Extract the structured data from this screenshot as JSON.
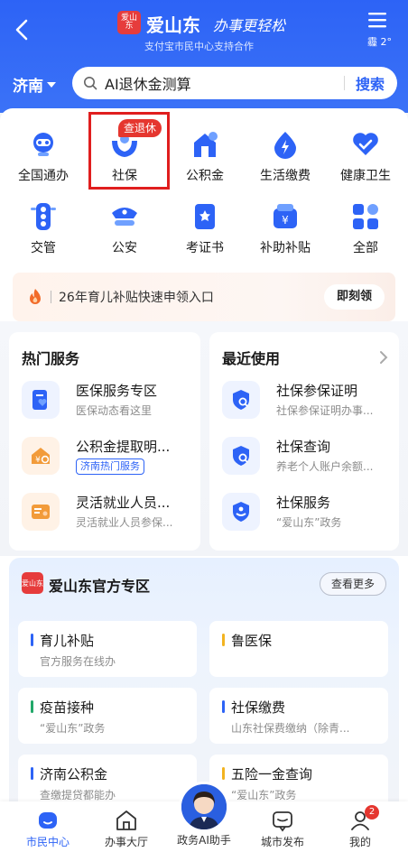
{
  "header": {
    "app_name": "爱山东",
    "badge_text": "爱山东",
    "slogan": "办事更轻松",
    "subtitle": "支付宝市民中心支持合作",
    "weather": "霾 2°",
    "city": "济南",
    "search_placeholder": "AI退休金测算",
    "search_button": "搜索"
  },
  "grid": {
    "items": [
      {
        "label": "全国通办",
        "icon": "nationwide-icon"
      },
      {
        "label": "社保",
        "icon": "social-security-icon",
        "badge": "查退休"
      },
      {
        "label": "公积金",
        "icon": "housing-fund-icon"
      },
      {
        "label": "生活缴费",
        "icon": "bill-payment-icon"
      },
      {
        "label": "健康卫生",
        "icon": "health-icon"
      },
      {
        "label": "交管",
        "icon": "traffic-light-icon"
      },
      {
        "label": "公安",
        "icon": "police-icon"
      },
      {
        "label": "考证书",
        "icon": "certificate-icon"
      },
      {
        "label": "补助补贴",
        "icon": "subsidy-icon"
      },
      {
        "label": "全部",
        "icon": "all-apps-icon"
      }
    ]
  },
  "promo": {
    "text": "26年育儿补贴快速申领入口",
    "button": "即刻领"
  },
  "hot_services": {
    "title": "热门服务",
    "items": [
      {
        "title": "医保服务专区",
        "sub": "医保动态看这里"
      },
      {
        "title": "公积金提取明...",
        "tag": "济南热门服务"
      },
      {
        "title": "灵活就业人员...",
        "sub": "灵活就业人员参保..."
      }
    ]
  },
  "recent": {
    "title": "最近使用",
    "items": [
      {
        "title": "社保参保证明",
        "sub": "社保参保证明办事..."
      },
      {
        "title": "社保查询",
        "sub": "养老个人账户余额..."
      },
      {
        "title": "社保服务",
        "sub": "“爱山东”政务"
      }
    ]
  },
  "official": {
    "logo_text": "爱山东",
    "title": "爱山东官方专区",
    "more": "查看更多",
    "tiles": [
      {
        "title": "育儿补贴",
        "sub": "官方服务在线办",
        "color": "#2d63f6"
      },
      {
        "title": "鲁医保",
        "sub": "",
        "color": "#f2b320"
      },
      {
        "title": "疫苗接种",
        "sub": "“爱山东”政务",
        "color": "#22a86a"
      },
      {
        "title": "社保缴费",
        "sub": "山东社保费缴纳（除青...",
        "color": "#2d63f6"
      },
      {
        "title": "济南公积金",
        "sub": "查缴提贷都能办",
        "color": "#2d63f6"
      },
      {
        "title": "五险一金查询",
        "sub": "“爱山东”政务",
        "color": "#f2b320"
      }
    ]
  },
  "tabbar": {
    "items": [
      {
        "label": "市民中心",
        "active": true
      },
      {
        "label": "办事大厅"
      },
      {
        "label": "政务AI助手"
      },
      {
        "label": "城市发布"
      },
      {
        "label": "我的",
        "badge": "2"
      }
    ]
  },
  "colors": {
    "brand_blue": "#2d63f6",
    "alert_red": "#e5362f"
  }
}
